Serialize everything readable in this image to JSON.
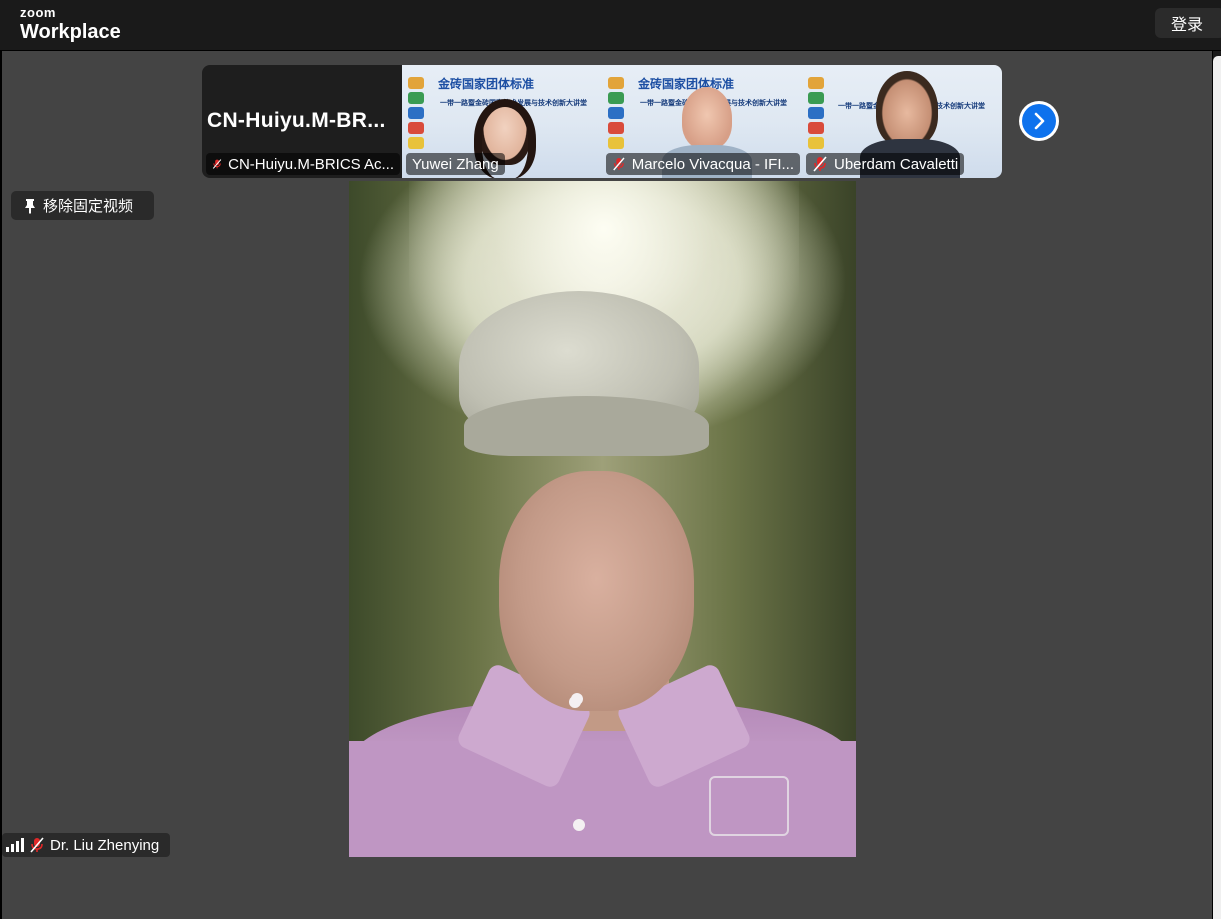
{
  "app": {
    "brand_small": "zoom",
    "brand_large": "Workplace",
    "login_label": "登录"
  },
  "gallery": {
    "tiles": [
      {
        "big_name": "CN-Huiyu.M-BR...",
        "label": "CN-Huiyu.M-BRICS Ac...",
        "muted": true
      },
      {
        "label": "Yuwei Zhang",
        "muted": false
      },
      {
        "label": "Marcelo Vivacqua - IFI...",
        "muted": true
      },
      {
        "label": "Uberdam Cavaletti",
        "muted": true
      }
    ],
    "slide": {
      "title": "金砖国家团体标准",
      "subtitle": "一带一路暨金砖国家技术发展与技术创新大讲堂"
    }
  },
  "controls": {
    "unpin_label": "移除固定视频",
    "next_icon": "chevron-right-icon"
  },
  "main_video": {
    "participant_name": "Dr. Liu Zhenying",
    "muted": true
  },
  "colors": {
    "accent": "#0e72ed",
    "muted_red": "#e02828",
    "stage_bg": "#444444"
  }
}
